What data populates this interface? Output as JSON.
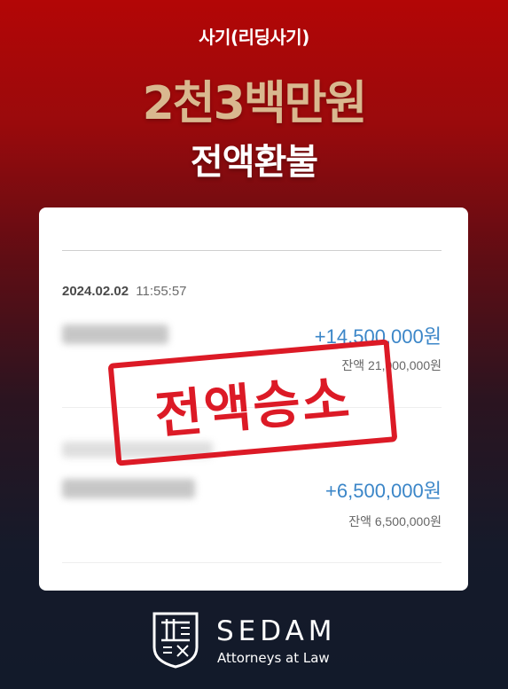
{
  "header": {
    "subtitle": "사기(리딩사기)",
    "amount": "2천3백만원",
    "refund": "전액환불"
  },
  "transactions": [
    {
      "date": "2024.02.02",
      "time": "11:55:57",
      "amount": "+14,500,000원",
      "balance": "잔액 21,000,000원"
    },
    {
      "amount": "+6,500,000원",
      "balance": "잔액 6,500,000원"
    }
  ],
  "stamp": {
    "text": "전액승소",
    "color": "#dc1a26"
  },
  "brand": {
    "name": "SEDAM",
    "tagline": "Attorneys at Law"
  },
  "colors": {
    "accent": "#3b86c8",
    "gold": "#d9b88f",
    "red": "#b30606",
    "navy": "#121a2a"
  }
}
